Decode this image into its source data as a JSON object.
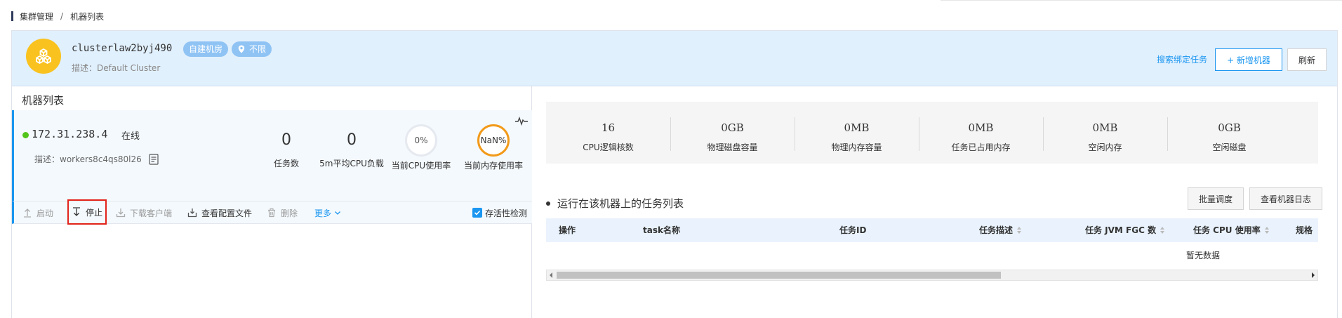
{
  "breadcrumb": {
    "parent": "集群管理",
    "separator": "/",
    "current": "机器列表"
  },
  "cluster": {
    "name": "clusterlaw2byj490",
    "tag_room": "自建机房",
    "tag_location": "不限",
    "description": "描述：Default Cluster",
    "search_link": "搜索绑定任务",
    "add_button": "+ 新增机器",
    "refresh_button": "刷新"
  },
  "machine_list": {
    "title": "机器列表",
    "machine": {
      "ip": "172.31.238.4",
      "status": "在线",
      "description": "描述：workers8c4qs80l26",
      "stats": [
        {
          "value": "0",
          "label": "任务数"
        },
        {
          "value": "0",
          "label": "5m平均CPU负载"
        },
        {
          "value": "0%",
          "label": "当前CPU使用率"
        },
        {
          "value": "NaN%",
          "label": "当前内存使用率"
        }
      ]
    },
    "toolbar": {
      "start": "启动",
      "stop": "停止",
      "download_client": "下载客户端",
      "view_config": "查看配置文件",
      "delete": "删除",
      "more": "更多",
      "liveness": "存活性检测"
    }
  },
  "metrics": [
    {
      "value": "16",
      "label": "CPU逻辑核数"
    },
    {
      "value": "0GB",
      "label": "物理磁盘容量"
    },
    {
      "value": "0MB",
      "label": "物理内存容量"
    },
    {
      "value": "0MB",
      "label": "任务已占用内存"
    },
    {
      "value": "0MB",
      "label": "空闲内存"
    },
    {
      "value": "0GB",
      "label": "空闲磁盘"
    }
  ],
  "tasks": {
    "title": "运行在该机器上的任务列表",
    "batch_button": "批量调度",
    "log_button": "查看机器日志",
    "columns": [
      "操作",
      "task名称",
      "任务ID",
      "任务描述",
      "任务 JVM FGC 数",
      "任务 CPU 使用率",
      "规格"
    ],
    "empty_text": "暂无数据"
  },
  "colors": {
    "accent": "#1a96f0",
    "header_bg": "#e1f0fd",
    "online": "#52c41a",
    "memory_ring": "#f29a1a",
    "avatar": "#f9c21f",
    "highlight": "#e2231a"
  }
}
